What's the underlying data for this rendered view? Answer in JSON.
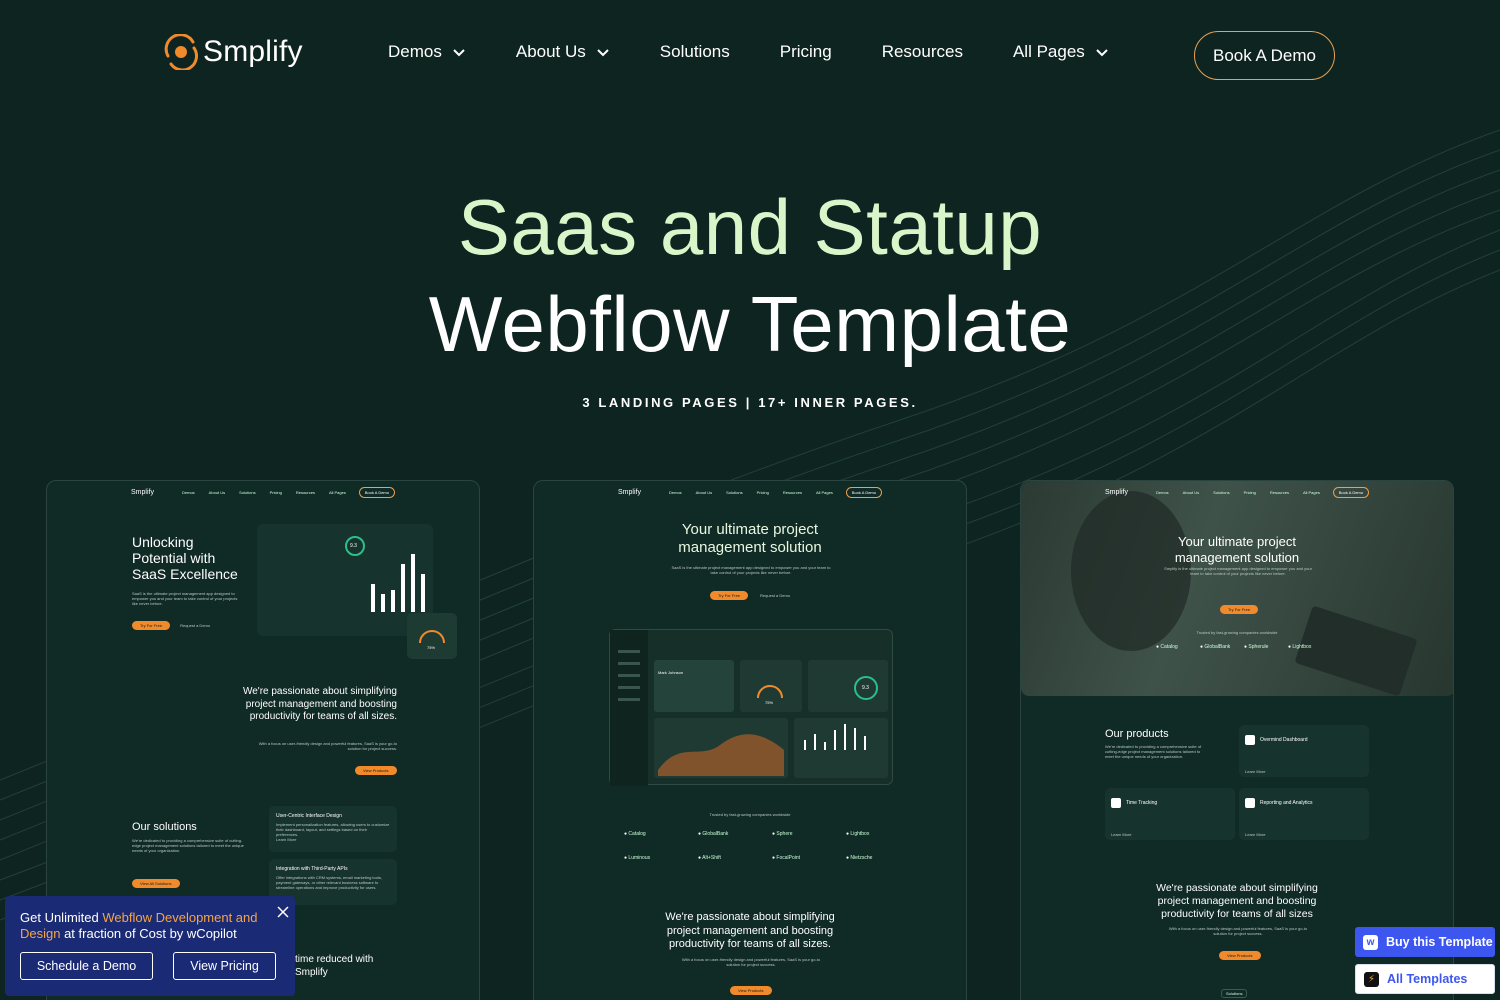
{
  "brand": {
    "name": "Smplify",
    "accent": "#f08a2a",
    "background": "#0e2420"
  },
  "nav": {
    "items": [
      {
        "label": "Demos",
        "dropdown": true
      },
      {
        "label": "About Us",
        "dropdown": true
      },
      {
        "label": "Solutions",
        "dropdown": false
      },
      {
        "label": "Pricing",
        "dropdown": false
      },
      {
        "label": "Resources",
        "dropdown": false
      },
      {
        "label": "All Pages",
        "dropdown": true
      }
    ],
    "cta": "Book A Demo"
  },
  "hero": {
    "line1": "Saas and Statup",
    "line2": "Webflow Template",
    "subtitle": "3 LANDING PAGES | 17+ INNER PAGES."
  },
  "previews": {
    "common": {
      "logo": "Smplify",
      "menu": [
        "Demos",
        "About Us",
        "Solutions",
        "Pricing",
        "Resources",
        "All Pages"
      ],
      "button": "Book A Demo"
    },
    "card1": {
      "headline": "Unlocking Potential with SaaS Excellence",
      "intro": "SaaS is the ultimate project management app designed to empower you and your team to take control of your projects like never before.",
      "primary": "Try For Free",
      "secondary": "Request a Demo",
      "score": "9.3",
      "percent": "75%",
      "passion": "We're passionate about simplifying project management and boosting productivity for teams of all sizes.",
      "passion_sub": "With a focus on user-friendly design and powerful features, SaaS is your go-to solution for project success.",
      "view_products": "View Products",
      "solutions_title": "Our solutions",
      "solutions_text": "We're dedicated to providing a comprehensive suite of cutting-edge project management solutions tailored to meet the unique needs of your organization.",
      "solutions_btn": "View All Solutions",
      "box1_title": "User-Centric Interface Design",
      "box1_text": "Implement personalization features, allowing users to customize their dashboard, layout, and settings based on their preferences.",
      "box2_title": "Integration with Third-Party APIs",
      "box2_text": "Offer integrations with CRM systems, email marketing tools, payment gateways, or other relevant business software to streamline operations and improve productivity for users.",
      "learn_more": "Learn More",
      "stat_text": "time reduced with Smplify"
    },
    "card2": {
      "headline": "Your ultimate project management solution",
      "intro": "SaaS is the ultimate project management app designed to empower you and your team to take control of your projects like never before.",
      "primary": "Try For Free",
      "secondary": "Request a Demo",
      "trusted": "Trusted by fast-growing companies worldwide",
      "logos": [
        "Catalog",
        "GlobalBank",
        "Sphere",
        "Lightbox",
        "Luminous",
        "Alt+Shift",
        "FocalPoint",
        "Nietzsche"
      ],
      "dashboard_user": "Mark Johnson",
      "dashboard_score": "9.3",
      "dashboard_percent": "75%",
      "passion": "We're passionate about simplifying project management and boosting productivity for teams of all sizes.",
      "passion_sub": "With a focus on user-friendly design and powerful features, SaaS is your go-to solution for project success.",
      "view_products": "View Products"
    },
    "card3": {
      "headline": "Your ultimate project management solution",
      "intro": "Smplify is the ultimate project management app designed to empower you and your team to take control of your projects like never before.",
      "primary": "Try For Free",
      "trusted": "Trusted by fast-growing companies worldwide",
      "logos": [
        "Catalog",
        "GlobalBank",
        "Spherule",
        "Lightbox"
      ],
      "products_title": "Our products",
      "products_text": "We're dedicated to providing a comprehensive suite of cutting-edge project management solutions tailored to meet the unique needs of your organization.",
      "product1": "Overmind Dashboard",
      "product2": "Time Tracking",
      "product3": "Reporting and Analytics",
      "learn_more": "Learn More",
      "passion": "We're passionate about simplifying project management and boosting productivity for teams of all sizes",
      "passion_sub": "With a focus on user-friendly design and powerful features, SaaS is your go-to solution for project success.",
      "view_products": "View Products",
      "solutions": "Solutions"
    }
  },
  "popup": {
    "text_before": "Get Unlimited ",
    "highlight": "Webflow Development and Design",
    "text_after": " at fraction of Cost by wCopilot",
    "button1": "Schedule a Demo",
    "button2": "View Pricing"
  },
  "badges": {
    "buy": "Buy this Template",
    "all": "All Templates"
  }
}
